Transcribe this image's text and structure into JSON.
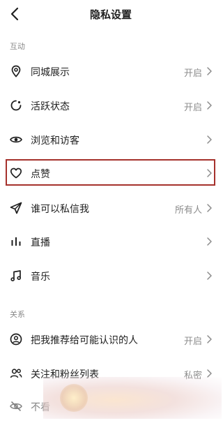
{
  "header": {
    "title": "隐私设置",
    "back_icon": "chevron-left-icon"
  },
  "sections": {
    "interaction": "互动",
    "relation": "关系"
  },
  "rows": [
    {
      "label": "同城展示",
      "value": "开启",
      "icon": "location-pin-icon"
    },
    {
      "label": "活跃状态",
      "value": "开启",
      "icon": "activity-icon"
    },
    {
      "label": "浏览和访客",
      "value": "",
      "icon": "eye-icon"
    },
    {
      "label": "点赞",
      "value": "",
      "icon": "heart-icon",
      "highlighted": true
    },
    {
      "label": "谁可以私信我",
      "value": "所有人",
      "icon": "send-icon"
    },
    {
      "label": "直播",
      "value": "",
      "icon": "bars-icon"
    },
    {
      "label": "音乐",
      "value": "",
      "icon": "music-note-icon"
    },
    {
      "label": "把我推荐给可能认识的人",
      "value": "开启",
      "icon": "user-circle-icon"
    },
    {
      "label": "关注和粉丝列表",
      "value": "私密",
      "icon": "users-icon"
    },
    {
      "label": "不看",
      "value": "",
      "icon": "eye-off-icon"
    }
  ],
  "colors": {
    "highlight_border": "#a5312c",
    "secondary_text": "#8c8c8c",
    "primary_text": "#1f1f1f"
  }
}
